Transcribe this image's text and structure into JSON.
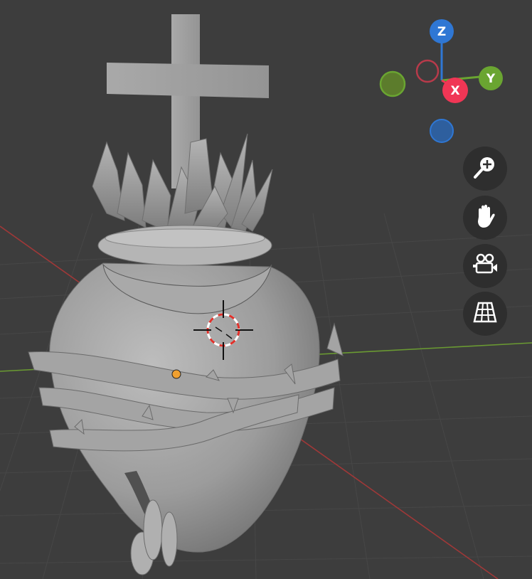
{
  "viewport": {
    "background_color": "#3d3d3d",
    "grid_color": "#474747",
    "axis_x_color": "#a03838",
    "axis_y_color": "#6a9a32",
    "object": "sculpted-sacred-heart-mesh",
    "origin_color": "#f0a030",
    "cursor_ring_colors": [
      "#ffffff",
      "#e0302a"
    ]
  },
  "gizmo": {
    "z_label": "Z",
    "y_label": "Y",
    "x_label": "X",
    "z_color": "#2f77d4",
    "y_color": "#6aa531",
    "x_color": "#f03655",
    "neg_x_color": "#b83a4a",
    "neg_y_color": "#5c7c2c",
    "neg_z_color": "#2e5f9e"
  },
  "nav_buttons": [
    {
      "icon": "zoom-icon",
      "name": "zoom-button"
    },
    {
      "icon": "hand-icon",
      "name": "pan-button"
    },
    {
      "icon": "camera-icon",
      "name": "camera-view-button"
    },
    {
      "icon": "grid-icon",
      "name": "perspective-toggle-button"
    }
  ]
}
